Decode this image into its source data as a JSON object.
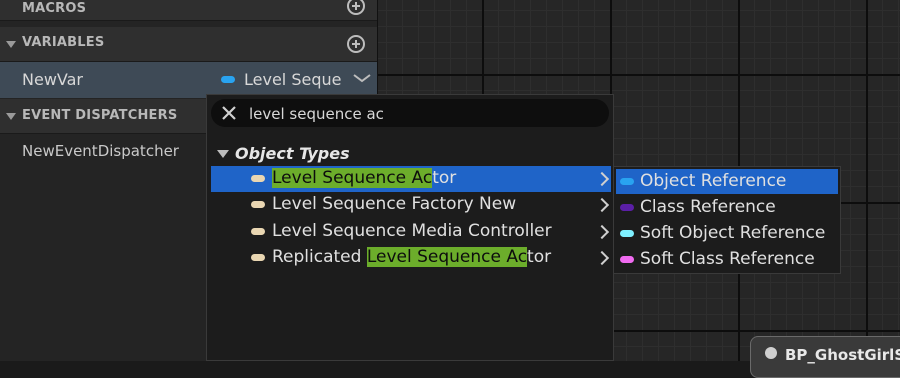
{
  "left_panel": {
    "sections": [
      {
        "label": "MACROS"
      },
      {
        "label": "VARIABLES"
      },
      {
        "label": "EVENT DISPATCHERS"
      }
    ],
    "variable": {
      "name": "NewVar",
      "type_label": "Level Sequer",
      "pill_color": "#29a3f0"
    },
    "dispatcher": {
      "name": "NewEventDispatcher"
    }
  },
  "graph": {
    "node_title": "BP_GhostGirlS"
  },
  "popup": {
    "search": {
      "value": "level sequence ac",
      "placeholder": ""
    },
    "category": "Object Types",
    "rows": [
      {
        "prefix": "",
        "match": "Level Sequence Ac",
        "suffix": "tor"
      },
      {
        "prefix": "Level Sequence Factory New",
        "match": "",
        "suffix": ""
      },
      {
        "prefix": "Level Sequence Media Controller",
        "match": "",
        "suffix": ""
      },
      {
        "prefix": "Replicated ",
        "match": "Level Sequence Ac",
        "suffix": "tor"
      }
    ],
    "submenu": [
      {
        "label": "Object Reference",
        "color": "#29a3f0"
      },
      {
        "label": "Class Reference",
        "color": "#5b1fa6"
      },
      {
        "label": "Soft Object Reference",
        "color": "#7ff0ff"
      },
      {
        "label": "Soft Class Reference",
        "color": "#f06bf0"
      }
    ]
  }
}
